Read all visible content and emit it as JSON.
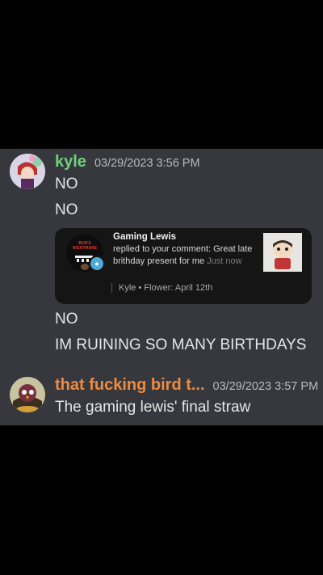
{
  "messages": [
    {
      "username": "kyle",
      "timestamp": "03/29/2023 3:56 PM",
      "lines": [
        "NO",
        "NO"
      ],
      "embed": {
        "logo_text": "BUN'S NIGHTMARE",
        "title": "Gaming Lewis",
        "body": "replied to your comment: Great late brithday present for me",
        "time": "Just now",
        "footer": "Kyle • Flower: April 12th"
      },
      "after_lines": [
        "NO",
        "IM RUINING SO MANY BIRTHDAYS"
      ]
    },
    {
      "username": "that fucking bird t...",
      "timestamp": "03/29/2023 3:57 PM",
      "lines": [
        "The gaming lewis' final straw"
      ]
    }
  ],
  "colors": {
    "kyle": "#6fd07a",
    "bird": "#f08a3c",
    "chat_bg": "#37383d"
  },
  "icons": {
    "embed_badge": "comment-icon"
  }
}
